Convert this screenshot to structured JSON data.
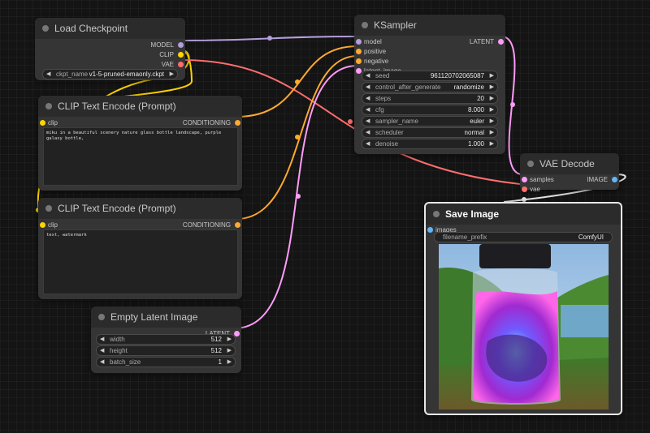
{
  "colors": {
    "model": "#b39ddb",
    "clip": "#ffd500",
    "vae": "#ff6e6e",
    "conditioning": "#ffa931",
    "latent": "#ff9cf9",
    "image": "#64b5f6"
  },
  "load_checkpoint": {
    "title": "Load Checkpoint",
    "outputs": [
      "MODEL",
      "CLIP",
      "VAE"
    ],
    "ckpt_label": "ckpt_name",
    "ckpt_value": "v1-5-pruned-emaonly.ckpt"
  },
  "clip_text_pos": {
    "title": "CLIP Text Encode (Prompt)",
    "input": "clip",
    "output": "CONDITIONING",
    "text": "miku in a beautiful scenery nature glass bottle landscape, purple galaxy bottle,"
  },
  "clip_text_neg": {
    "title": "CLIP Text Encode (Prompt)",
    "input": "clip",
    "output": "CONDITIONING",
    "text": "text, watermark"
  },
  "empty_latent": {
    "title": "Empty Latent Image",
    "output": "LATENT",
    "widgets": [
      {
        "label": "width",
        "value": "512"
      },
      {
        "label": "height",
        "value": "512"
      },
      {
        "label": "batch_size",
        "value": "1"
      }
    ]
  },
  "ksampler": {
    "title": "KSampler",
    "inputs": [
      "model",
      "positive",
      "negative",
      "latent_image"
    ],
    "output": "LATENT",
    "widgets": [
      {
        "label": "seed",
        "value": "961120702065087"
      },
      {
        "label": "control_after_generate",
        "value": "randomize"
      },
      {
        "label": "steps",
        "value": "20"
      },
      {
        "label": "cfg",
        "value": "8.000"
      },
      {
        "label": "sampler_name",
        "value": "euler"
      },
      {
        "label": "scheduler",
        "value": "normal"
      },
      {
        "label": "denoise",
        "value": "1.000"
      }
    ]
  },
  "vae_decode": {
    "title": "VAE Decode",
    "inputs": [
      "samples",
      "vae"
    ],
    "output": "IMAGE"
  },
  "save_image": {
    "title": "Save Image",
    "input": "images",
    "prefix_label": "filename_prefix",
    "prefix_value": "ComfyUI"
  }
}
